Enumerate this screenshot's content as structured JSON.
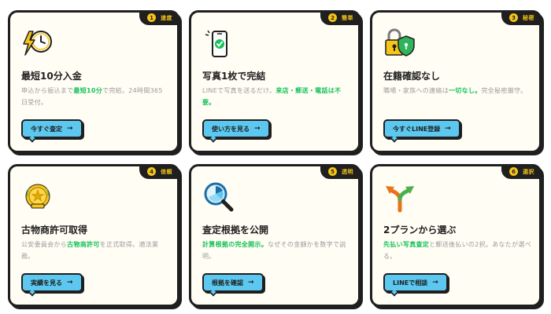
{
  "cards": [
    {
      "badge_num": "1",
      "badge_label": "速度",
      "icon": "lightning-clock-icon",
      "title": "最短10分入金",
      "desc_parts": [
        {
          "text": "申込から振込まで",
          "hl": false
        },
        {
          "text": "最短10分",
          "hl": true
        },
        {
          "text": "で完結。24時間365日受付。",
          "hl": false
        }
      ],
      "button": "今すぐ査定"
    },
    {
      "badge_num": "2",
      "badge_label": "簡単",
      "icon": "smartphone-check-icon",
      "title": "写真1枚で完結",
      "desc_parts": [
        {
          "text": "LINEで写真を送るだけ。",
          "hl": false
        },
        {
          "text": "来店・郵送・電話は不要。",
          "hl": true
        }
      ],
      "button": "使い方を見る"
    },
    {
      "badge_num": "3",
      "badge_label": "秘密",
      "icon": "lock-shield-icon",
      "title": "在籍確認なし",
      "desc_parts": [
        {
          "text": "職場・家族への連絡は",
          "hl": false
        },
        {
          "text": "一切なし。",
          "hl": true
        },
        {
          "text": "完全秘密厳守。",
          "hl": false
        }
      ],
      "button": "今すぐLINE登録"
    },
    {
      "badge_num": "4",
      "badge_label": "信頼",
      "icon": "medal-icon",
      "title": "古物商許可取得",
      "desc_parts": [
        {
          "text": "公安委員会から",
          "hl": false
        },
        {
          "text": "古物商許可",
          "hl": true
        },
        {
          "text": "を正式取得。適法業務。",
          "hl": false
        }
      ],
      "button": "実績を見る"
    },
    {
      "badge_num": "5",
      "badge_label": "透明",
      "icon": "magnifier-chart-icon",
      "title": "査定根拠を公開",
      "desc_parts": [
        {
          "text": "計算根拠の完全開示。",
          "hl": true
        },
        {
          "text": "なぜその金額かを数字で説明。",
          "hl": false
        }
      ],
      "button": "根拠を確認"
    },
    {
      "badge_num": "6",
      "badge_label": "選択",
      "icon": "split-arrow-icon",
      "title": "2プランから選ぶ",
      "desc_parts": [
        {
          "text": "先払い写真査定",
          "hl": true
        },
        {
          "text": "と郵送後払いの2択。あなたが選べる。",
          "hl": false
        }
      ],
      "button": "LINEで相談"
    }
  ],
  "arrow_glyph": "→",
  "colors": {
    "accent_yellow": "#f5c518",
    "button_blue": "#5cc8f0",
    "highlight_green": "#16c25a",
    "ink": "#1f1f1f"
  }
}
